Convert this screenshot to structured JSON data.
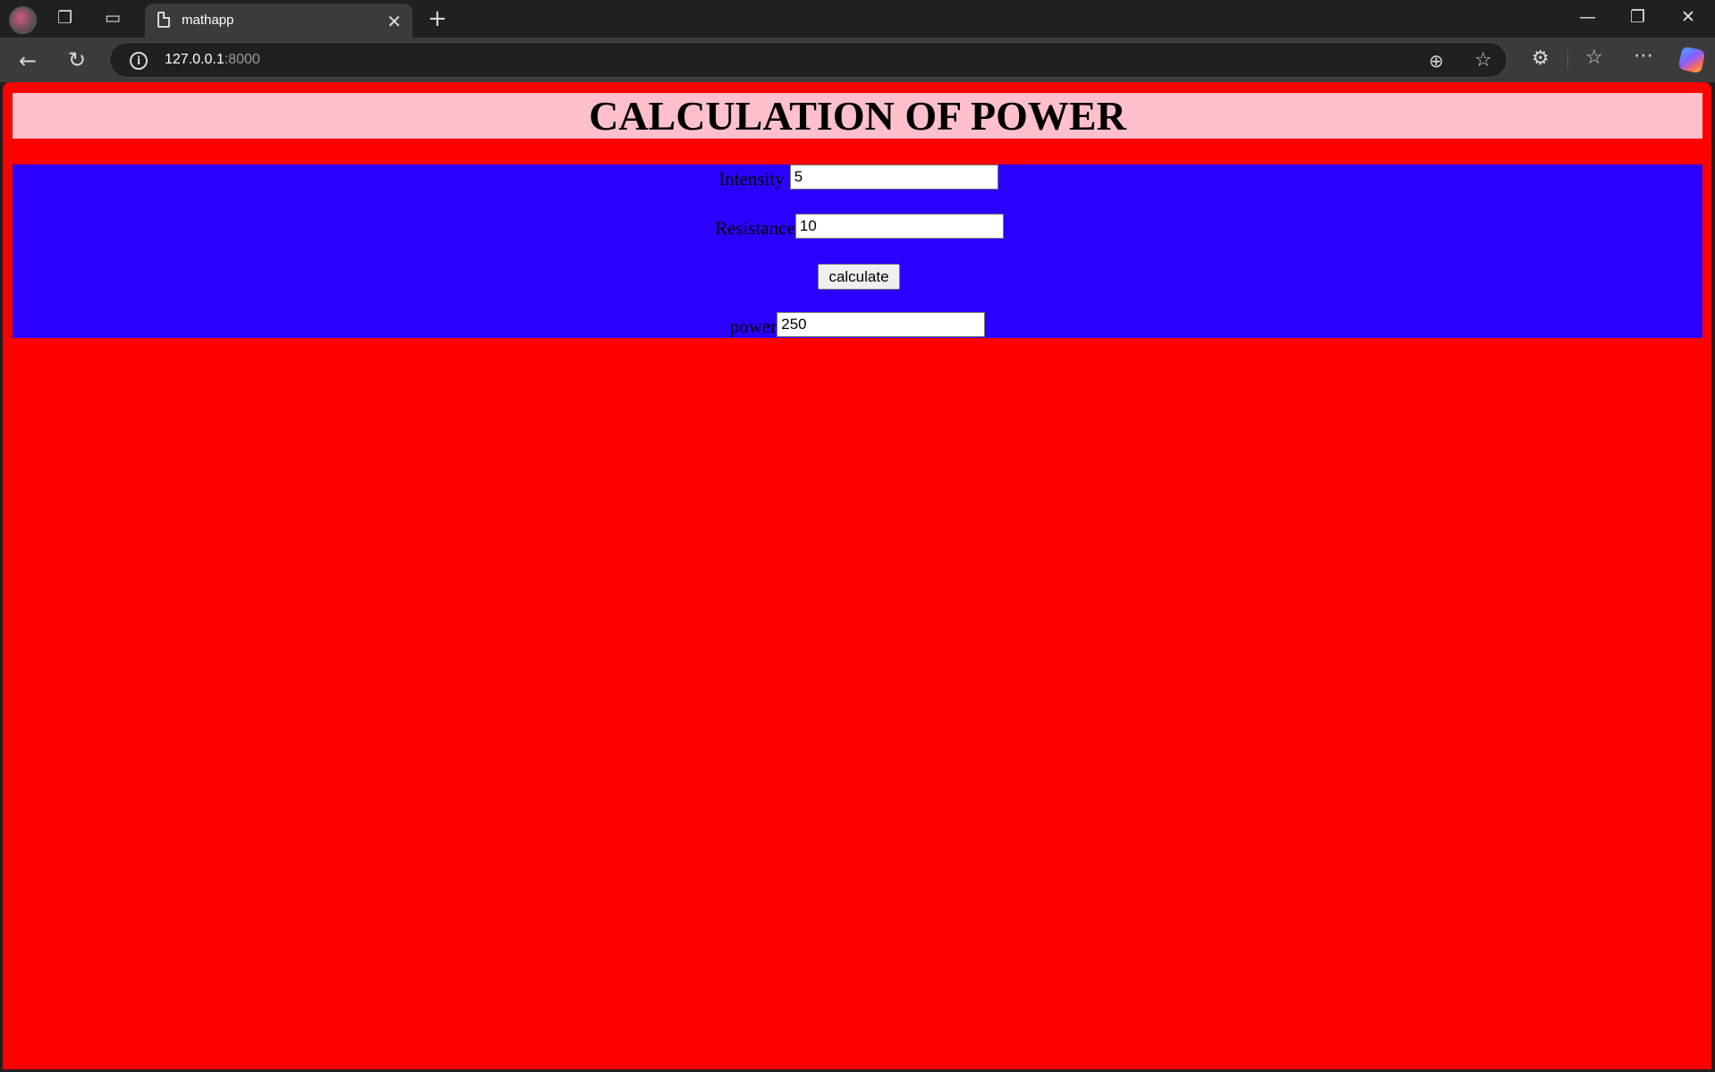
{
  "browser": {
    "tab_title": "mathapp",
    "url_host": "127.0.0.1",
    "url_port": ":8000"
  },
  "page": {
    "heading": "CALCULATION OF POWER",
    "form": {
      "intensity_label": "Intensity",
      "intensity_value": "5",
      "resistance_label": "Resistance",
      "resistance_value": "10",
      "calculate_label": "calculate",
      "power_label": "power",
      "power_value": "250"
    }
  },
  "colors": {
    "page_background": "#ff0000",
    "heading_background": "#ffc0cb",
    "form_background": "#2b00ff"
  }
}
